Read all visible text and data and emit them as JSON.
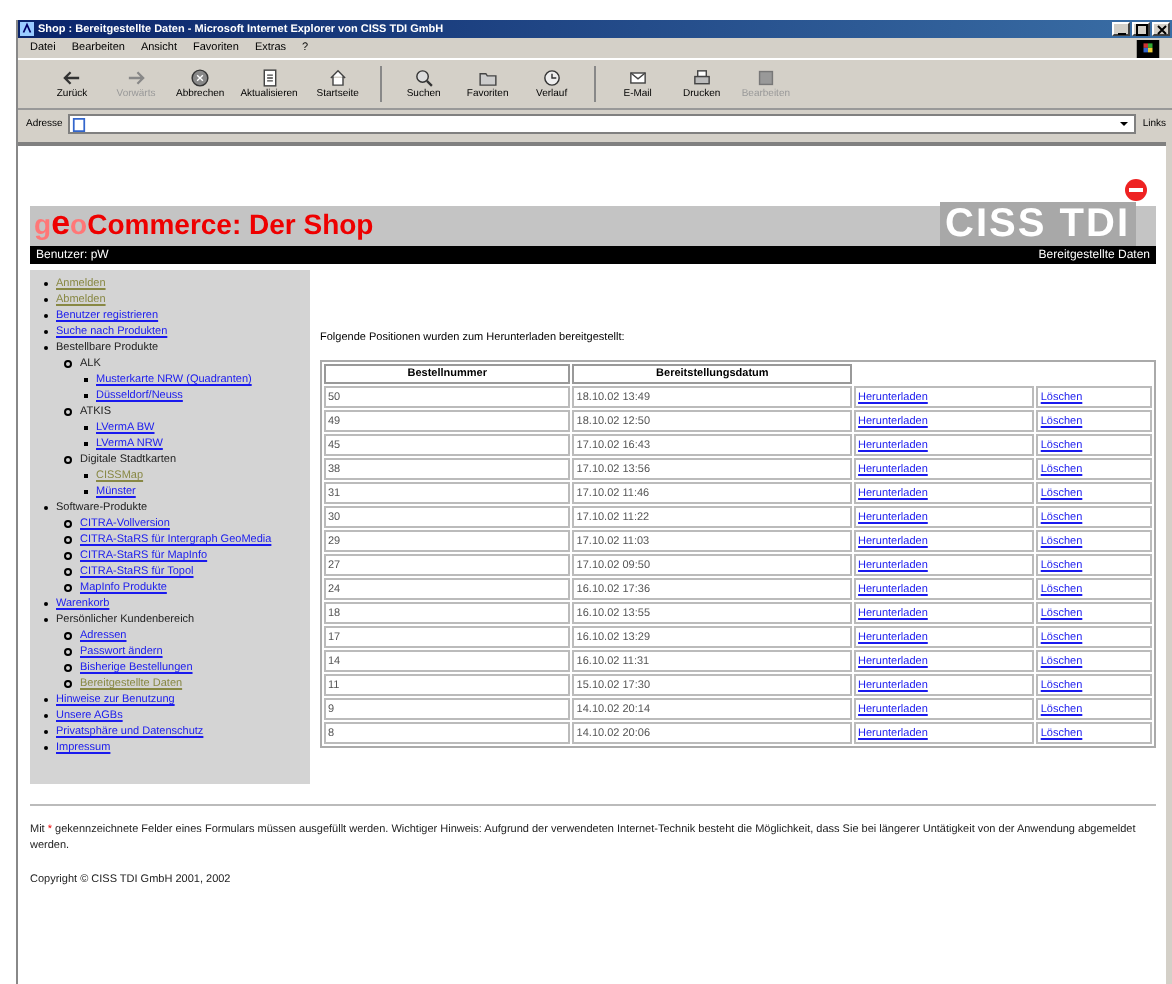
{
  "window": {
    "title": "Shop : Bereitgestellte Daten - Microsoft Internet Explorer von CISS TDI GmbH"
  },
  "menu": [
    "Datei",
    "Bearbeiten",
    "Ansicht",
    "Favoriten",
    "Extras",
    "?"
  ],
  "toolbar": [
    {
      "label": "Zurück",
      "disabled": false
    },
    {
      "label": "Vorwärts",
      "disabled": true
    },
    {
      "label": "Abbrechen",
      "disabled": false
    },
    {
      "label": "Aktualisieren",
      "disabled": false
    },
    {
      "label": "Startseite",
      "disabled": false
    },
    {
      "label": "Suchen",
      "disabled": false
    },
    {
      "label": "Favoriten",
      "disabled": false
    },
    {
      "label": "Verlauf",
      "disabled": false
    },
    {
      "label": "E-Mail",
      "disabled": false
    },
    {
      "label": "Drucken",
      "disabled": false
    },
    {
      "label": "Bearbeiten",
      "disabled": true
    }
  ],
  "address": {
    "label": "Adresse",
    "links": "Links"
  },
  "header": {
    "logo": [
      {
        "text": "g",
        "kind": "faded"
      },
      {
        "text": "e",
        "kind": "big"
      },
      {
        "text": "o",
        "kind": "faded"
      },
      {
        "text": "Commerce: Der Shop",
        "kind": "plain"
      }
    ],
    "brand": "CISS TDI",
    "user": "Benutzer: pW",
    "section": "Bereitgestellte Daten"
  },
  "sidebar": {
    "items": [
      {
        "text": "Anmelden",
        "kind": "link",
        "visited": true
      },
      {
        "text": "Abmelden",
        "kind": "link",
        "visited": true
      },
      {
        "text": "Benutzer registrieren",
        "kind": "link",
        "visited": false
      },
      {
        "text": "Suche nach Produkten",
        "kind": "link",
        "visited": false
      },
      {
        "text": "Bestellbare Produkte",
        "kind": "heading",
        "children": [
          {
            "text": "ALK",
            "kind": "heading",
            "children": [
              {
                "text": "Musterkarte NRW (Quadranten)",
                "kind": "link",
                "visited": false
              },
              {
                "text": "Düsseldorf/Neuss",
                "kind": "link",
                "visited": false
              }
            ]
          },
          {
            "text": "ATKIS",
            "kind": "heading",
            "children": [
              {
                "text": "LVermA BW",
                "kind": "link",
                "visited": false
              },
              {
                "text": "LVermA NRW",
                "kind": "link",
                "visited": false
              }
            ]
          },
          {
            "text": "Digitale Stadtkarten",
            "kind": "heading",
            "children": [
              {
                "text": "CISSMap",
                "kind": "link",
                "visited": true
              },
              {
                "text": "Münster",
                "kind": "link",
                "visited": false
              }
            ]
          }
        ]
      },
      {
        "text": "Software-Produkte",
        "kind": "heading",
        "children": [
          {
            "text": "CITRA-Vollversion",
            "kind": "link",
            "visited": false
          },
          {
            "text": "CITRA-StaRS für Intergraph GeoMedia",
            "kind": "link",
            "visited": false
          },
          {
            "text": "CITRA-StaRS für MapInfo",
            "kind": "link",
            "visited": false
          },
          {
            "text": "CITRA-StaRS für Topol",
            "kind": "link",
            "visited": false
          },
          {
            "text": "MapInfo Produkte",
            "kind": "link",
            "visited": false
          }
        ]
      },
      {
        "text": "Warenkorb",
        "kind": "link",
        "visited": false
      },
      {
        "text": "Persönlicher Kundenbereich",
        "kind": "heading",
        "children": [
          {
            "text": "Adressen",
            "kind": "link",
            "visited": false
          },
          {
            "text": "Passwort ändern",
            "kind": "link",
            "visited": false
          },
          {
            "text": "Bisherige Bestellungen",
            "kind": "link",
            "visited": false
          },
          {
            "text": "Bereitgestellte Daten",
            "kind": "link",
            "visited": true
          }
        ]
      },
      {
        "text": "Hinweise zur Benutzung",
        "kind": "link",
        "visited": false
      },
      {
        "text": "Unsere AGBs",
        "kind": "link",
        "visited": false
      },
      {
        "text": "Privatsphäre und Datenschutz",
        "kind": "link",
        "visited": false
      },
      {
        "text": "Impressum",
        "kind": "link",
        "visited": false
      }
    ]
  },
  "intro": "Folgende Positionen wurden zum Herunterladen bereitgestellt:",
  "table": {
    "columns": [
      "Bestellnummer",
      "Bereitstellungsdatum"
    ],
    "rows": [
      {
        "number": "50",
        "date": "18.10.02 13:49",
        "download": "Herunterladen",
        "delete": "Löschen"
      },
      {
        "number": "49",
        "date": "18.10.02 12:50",
        "download": "Herunterladen",
        "delete": "Löschen"
      },
      {
        "number": "45",
        "date": "17.10.02 16:43",
        "download": "Herunterladen",
        "delete": "Löschen"
      },
      {
        "number": "38",
        "date": "17.10.02 13:56",
        "download": "Herunterladen",
        "delete": "Löschen"
      },
      {
        "number": "31",
        "date": "17.10.02 11:46",
        "download": "Herunterladen",
        "delete": "Löschen"
      },
      {
        "number": "30",
        "date": "17.10.02 11:22",
        "download": "Herunterladen",
        "delete": "Löschen"
      },
      {
        "number": "29",
        "date": "17.10.02 11:03",
        "download": "Herunterladen",
        "delete": "Löschen"
      },
      {
        "number": "27",
        "date": "17.10.02 09:50",
        "download": "Herunterladen",
        "delete": "Löschen"
      },
      {
        "number": "24",
        "date": "16.10.02 17:36",
        "download": "Herunterladen",
        "delete": "Löschen"
      },
      {
        "number": "18",
        "date": "16.10.02 13:55",
        "download": "Herunterladen",
        "delete": "Löschen"
      },
      {
        "number": "17",
        "date": "16.10.02 13:29",
        "download": "Herunterladen",
        "delete": "Löschen"
      },
      {
        "number": "14",
        "date": "16.10.02 11:31",
        "download": "Herunterladen",
        "delete": "Löschen"
      },
      {
        "number": "11",
        "date": "15.10.02 17:30",
        "download": "Herunterladen",
        "delete": "Löschen"
      },
      {
        "number": "9",
        "date": "14.10.02 20:14",
        "download": "Herunterladen",
        "delete": "Löschen"
      },
      {
        "number": "8",
        "date": "14.10.02 20:06",
        "download": "Herunterladen",
        "delete": "Löschen"
      }
    ]
  },
  "footer": {
    "note_before": "Mit",
    "note_mark": "*",
    "note_after": "gekennzeichnete Felder eines Formulars müssen ausgefüllt werden. Wichtiger Hinweis: Aufgrund der verwendeten Internet-Technik besteht die Möglichkeit, dass Sie bei längerer Untätigkeit von der Anwendung abgemeldet werden.",
    "copyright": "Copyright © CISS TDI GmbH 2001, 2002"
  }
}
